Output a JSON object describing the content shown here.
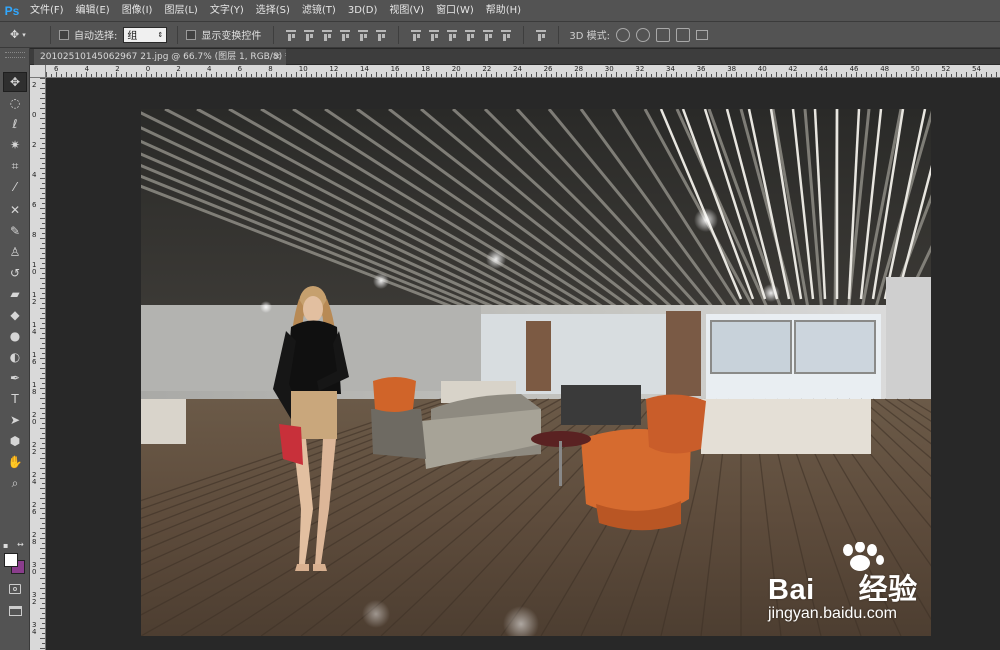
{
  "app": {
    "logo": "Ps"
  },
  "menu": [
    {
      "label": "文件(F)"
    },
    {
      "label": "编辑(E)"
    },
    {
      "label": "图像(I)"
    },
    {
      "label": "图层(L)"
    },
    {
      "label": "文字(Y)"
    },
    {
      "label": "选择(S)"
    },
    {
      "label": "滤镜(T)"
    },
    {
      "label": "3D(D)"
    },
    {
      "label": "视图(V)"
    },
    {
      "label": "窗口(W)"
    },
    {
      "label": "帮助(H)"
    }
  ],
  "options": {
    "auto_select_label": "自动选择:",
    "auto_select_value": "组",
    "show_transform_label": "显示变换控件",
    "mode_3d_label": "3D 模式:"
  },
  "document": {
    "tab_title": "20102510145062967 21.jpg @ 66.7% (图层 1, RGB/8) *",
    "close_glyph": "×"
  },
  "rulers": {
    "horizontal": [
      "6",
      "4",
      "2",
      "0",
      "2",
      "4",
      "6",
      "8",
      "10",
      "12",
      "14",
      "16",
      "18",
      "20",
      "22",
      "24",
      "26",
      "28",
      "30",
      "32",
      "34",
      "36",
      "38",
      "40",
      "42",
      "44",
      "46",
      "48",
      "50",
      "52",
      "54",
      "56"
    ],
    "vertical": [
      "2",
      "0",
      "2",
      "4",
      "6",
      "8",
      "10",
      "12",
      "14",
      "16",
      "18",
      "20",
      "22",
      "24",
      "26",
      "28",
      "30",
      "32",
      "34"
    ]
  },
  "tools": [
    {
      "name": "move-tool-icon",
      "glyph": "✥"
    },
    {
      "name": "marquee-tool-icon",
      "glyph": "◌"
    },
    {
      "name": "lasso-tool-icon",
      "glyph": "ℓ"
    },
    {
      "name": "magic-wand-tool-icon",
      "glyph": "✷"
    },
    {
      "name": "crop-tool-icon",
      "glyph": "⌗"
    },
    {
      "name": "eyedropper-tool-icon",
      "glyph": "⁄"
    },
    {
      "name": "healing-brush-tool-icon",
      "glyph": "✕"
    },
    {
      "name": "brush-tool-icon",
      "glyph": "✎"
    },
    {
      "name": "clone-stamp-tool-icon",
      "glyph": "♙"
    },
    {
      "name": "history-brush-tool-icon",
      "glyph": "↺"
    },
    {
      "name": "eraser-tool-icon",
      "glyph": "▰"
    },
    {
      "name": "paint-bucket-tool-icon",
      "glyph": "◆"
    },
    {
      "name": "blur-tool-icon",
      "glyph": "●"
    },
    {
      "name": "dodge-tool-icon",
      "glyph": "◐"
    },
    {
      "name": "pen-tool-icon",
      "glyph": "✒"
    },
    {
      "name": "type-tool-icon",
      "glyph": "T"
    },
    {
      "name": "path-selection-tool-icon",
      "glyph": "➤"
    },
    {
      "name": "shape-tool-icon",
      "glyph": "⬢"
    },
    {
      "name": "hand-tool-icon",
      "glyph": "✋"
    },
    {
      "name": "zoom-tool-icon",
      "glyph": "⌕"
    }
  ],
  "colors": {
    "foreground": "#ffffff",
    "background": "#8a3d8c",
    "accent": "#31a8ff"
  },
  "watermark": {
    "brand": "Bai",
    "brand_cn": "经验",
    "url": "jingyan.baidu.com"
  }
}
